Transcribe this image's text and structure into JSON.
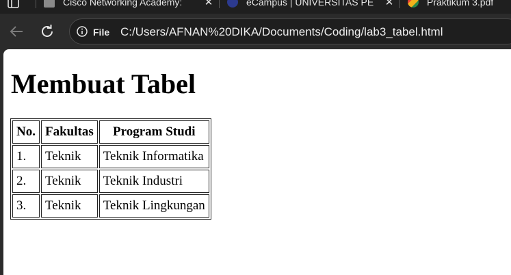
{
  "tabs": [
    {
      "title": "Cisco Networking Academy: ",
      "favicon": "cisco-favicon",
      "color": "#8a8a8a"
    },
    {
      "title": "eCampus | UNIVERSITAS PE",
      "favicon": "ecampus-favicon",
      "color": "#2c3a8f"
    },
    {
      "title": "Praktikum 3.pdf",
      "favicon": "drive-favicon",
      "color": "#f3b21b"
    }
  ],
  "toolbar": {
    "site_chip": "File",
    "url": "C:/Users/AFNAN%20DIKA/Documents/Coding/lab3_tabel.html"
  },
  "page": {
    "heading": "Membuat Tabel",
    "table": {
      "headers": [
        "No.",
        "Fakultas",
        "Program Studi"
      ],
      "rows": [
        [
          "1.",
          "Teknik",
          "Teknik Informatika"
        ],
        [
          "2.",
          "Teknik",
          "Teknik Industri"
        ],
        [
          "3.",
          "Teknik",
          "Teknik Lingkungan"
        ]
      ]
    }
  }
}
